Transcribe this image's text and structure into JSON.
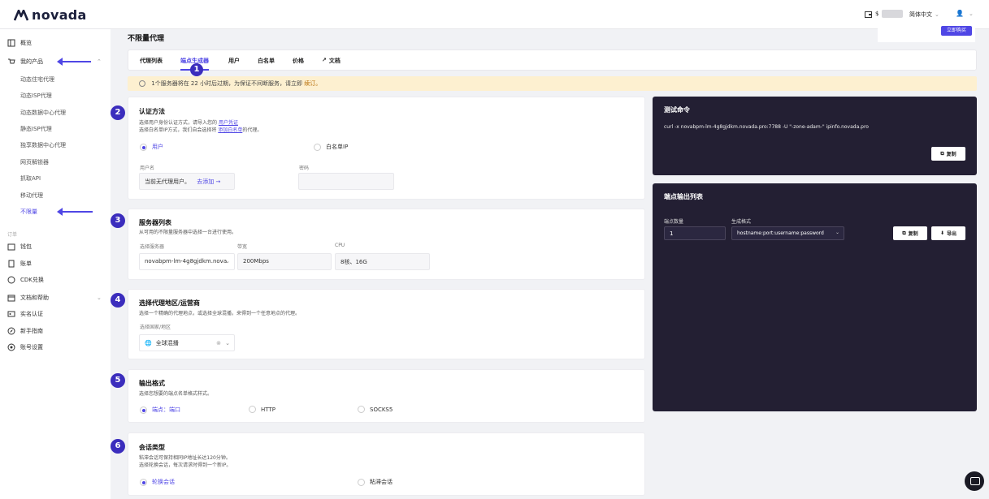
{
  "brand": {
    "name": "novada"
  },
  "header": {
    "wallet_prefix": "$",
    "language": "简体中文"
  },
  "sidebar": {
    "overview": "概览",
    "my_products": "我的产品",
    "products": [
      "动态住宅代理",
      "动态ISP代理",
      "动态数据中心代理",
      "静态ISP代理",
      "独享数据中心代理",
      "网页解锁器",
      "抓取API",
      "移动代理",
      "不限量"
    ],
    "group_label": "订单",
    "items": [
      "钱包",
      "账单",
      "CDK兑换",
      "文档和帮助",
      "实名认证",
      "新手指南",
      "账号设置"
    ]
  },
  "page": {
    "title": "不限量代理"
  },
  "tabs": {
    "items": [
      "代理列表",
      "端点生成器",
      "用户",
      "白名单",
      "价格",
      "文档"
    ],
    "active": "端点生成器",
    "marker": "1"
  },
  "notice": {
    "text": "1个服务器将在 22 小时后过期，为保证不间断服务，请立即",
    "link": "续订。"
  },
  "auth": {
    "step": "2",
    "title": "认证方法",
    "desc1": "选择用户身份认证方式，请导入您的",
    "link1": "用户凭证",
    "desc2": "选择白名单IP方式，我们自会选择将",
    "link2": "添加白名单",
    "desc2b": "的代理。",
    "option_user": "用户",
    "option_whitelist": "白名单IP",
    "username_label": "用户名",
    "username_value": "当前无代理用户。",
    "add_link": "去添加 →",
    "password_label": "密码"
  },
  "server": {
    "step": "3",
    "title": "服务器列表",
    "desc": "从可用的不限量服务器中选择一台进行使用。",
    "select_label": "选择服务器",
    "select_value": "novabpm-lm-4g8gjdkm.nova",
    "bw_label": "带宽",
    "bw_value": "200Mbps",
    "cpu_label": "CPU",
    "cpu_value": "8核、16G"
  },
  "region": {
    "step": "4",
    "title": "选择代理地区/运营商",
    "desc": "选择一个精确的代理地点，或选择全球混播，来得到一个任意地点的代理。",
    "label": "选择国家/地区",
    "value": "全球混播"
  },
  "output": {
    "step": "5",
    "title": "输出格式",
    "desc": "选择您想要的端点名单格式样式。",
    "options": [
      "端点：端口",
      "HTTP",
      "SOCKS5"
    ]
  },
  "session": {
    "step": "6",
    "title": "会话类型",
    "desc1": "粘滞会话可保持相同IP地址长达120分钟。",
    "desc2": "选择轮换会话，每次请求时得到一个新IP。",
    "options": [
      "轮换会话",
      "粘滞会话"
    ]
  },
  "test": {
    "title": "测试命令",
    "command": "curl -x novabpm-lm-4g8gjdkm.novada.pro:7788 -U \"-zone-adam-\" ipinfo.novada.pro",
    "copy": "复制"
  },
  "endpoints": {
    "title": "端点输出列表",
    "count_label": "端点数量",
    "count_value": "1",
    "format_label": "生成格式",
    "format_value": "hostname:port:username:password",
    "copy": "复制",
    "export": "导出"
  }
}
